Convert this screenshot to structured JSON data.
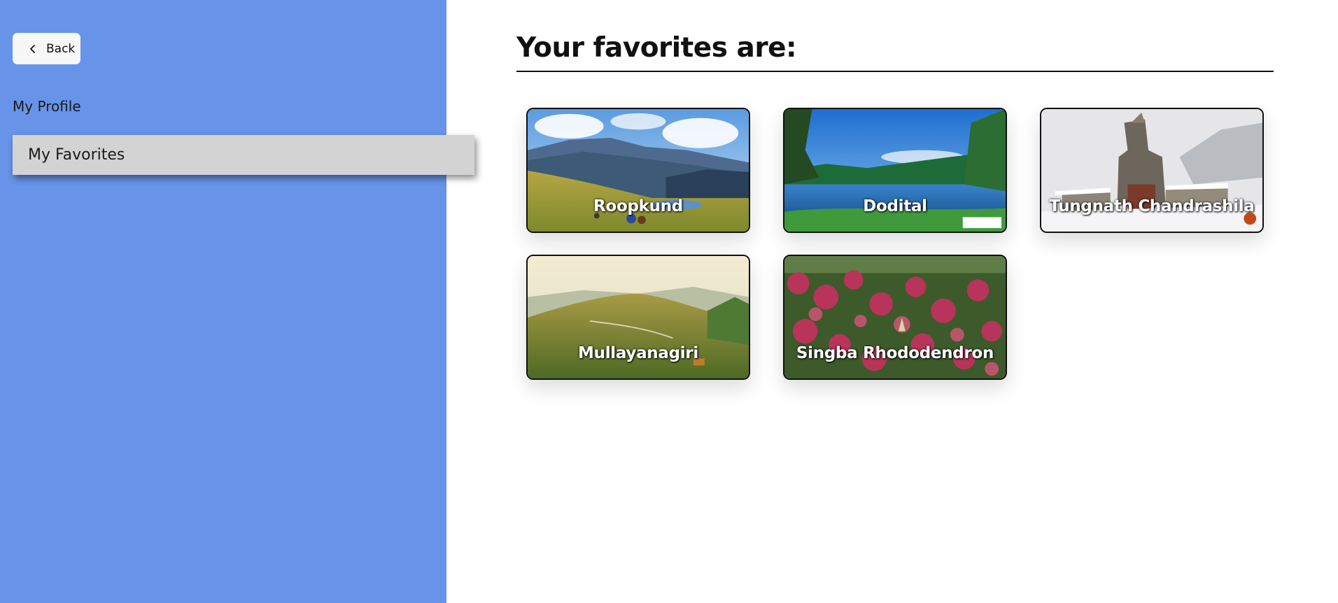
{
  "sidebar": {
    "back_label": "Back",
    "items": [
      {
        "label": "My Profile",
        "selected": false
      },
      {
        "label": "My Favorites",
        "selected": true
      }
    ],
    "background_color": "#6793e9"
  },
  "main": {
    "title": "Your favorites are:",
    "favorites": [
      {
        "name": "Roopkund"
      },
      {
        "name": "Dodital"
      },
      {
        "name": "Tungnath Chandrashila"
      },
      {
        "name": "Mullayanagiri"
      },
      {
        "name": "Singba Rhododendron"
      }
    ]
  }
}
